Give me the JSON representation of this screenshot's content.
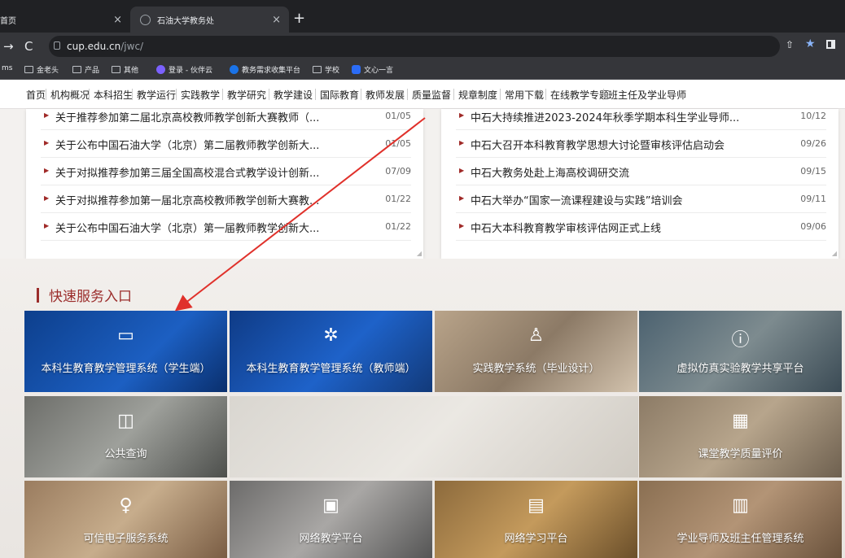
{
  "browser": {
    "tabs": [
      {
        "title": "首页"
      },
      {
        "title": "石油大学教务处"
      }
    ],
    "new_tab": "+",
    "url_host": "cup.edu.cn",
    "url_path": "/jwc/",
    "bookmarks": [
      "ms",
      "金老头",
      "产品",
      "其他",
      "登录 - 伙伴云",
      "教务需求收集平台",
      "学校",
      "文心一言"
    ]
  },
  "site_nav": [
    "首页",
    "机构概况",
    "本科招生",
    "教学运行",
    "实践教学",
    "教学研究",
    "教学建设",
    "国际教育",
    "教师发展",
    "质量监督",
    "规章制度",
    "常用下载",
    "在线教学专题",
    "班主任及学业导师"
  ],
  "left_news": [
    {
      "title": "关于推荐参加第二届北京高校教师教学创新大赛教师（...",
      "date": "01/05"
    },
    {
      "title": "关于公布中国石油大学（北京）第二届教师教学创新大...",
      "date": "01/05"
    },
    {
      "title": "关于对拟推荐参加第三届全国高校混合式教学设计创新...",
      "date": "07/09"
    },
    {
      "title": "关于对拟推荐参加第一届北京高校教师教学创新大赛教...",
      "date": "01/22"
    },
    {
      "title": "关于公布中国石油大学（北京）第一届教师教学创新大...",
      "date": "01/22"
    }
  ],
  "right_news": [
    {
      "title": "中石大持续推进2023-2024年秋季学期本科生学业导师...",
      "date": "10/12"
    },
    {
      "title": "中石大召开本科教育教学思想大讨论暨审核评估启动会",
      "date": "09/26"
    },
    {
      "title": "中石大教务处赴上海高校调研交流",
      "date": "09/15"
    },
    {
      "title": "中石大举办“国家一流课程建设与实践”培训会",
      "date": "09/11"
    },
    {
      "title": "中石大本科教育教学审核评估网正式上线",
      "date": "09/06"
    }
  ],
  "quick_section_title": "快速服务入口",
  "tiles": [
    {
      "label": "本科生教育教学管理系统（学生端）",
      "icon": "monitor-icon"
    },
    {
      "label": "本科生教育教学管理系统（教师端）",
      "icon": "network-icon"
    },
    {
      "label": "实践教学系统（毕业设计）",
      "icon": "graduate-icon"
    },
    {
      "label": "虚拟仿真实验教学共享平台",
      "icon": "screen-icon"
    },
    {
      "label": "公共查询",
      "icon": "box-icon"
    },
    {
      "label": "",
      "icon": ""
    },
    {
      "label": "课堂教学质量评价",
      "icon": "classroom-icon"
    },
    {
      "label": "可信电子服务系统",
      "icon": "users-icon"
    },
    {
      "label": "网络教学平台",
      "icon": "presentation-icon"
    },
    {
      "label": "网络学习平台",
      "icon": "learning-icon"
    },
    {
      "label": "学业导师及班主任管理系统",
      "icon": "document-icon"
    }
  ]
}
